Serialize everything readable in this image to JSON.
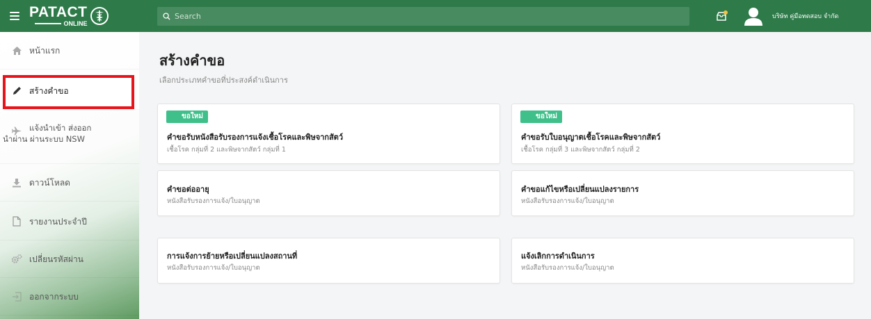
{
  "header": {
    "logo_main": "PATACT",
    "logo_sub": "ONLINE",
    "search_placeholder": "Search",
    "user_name": "บริษัท คู่มือทดสอบ จำกัด"
  },
  "sidebar": {
    "items": [
      {
        "label": "หน้าแรก",
        "icon": "home-icon"
      },
      {
        "label": "สร้างคำขอ",
        "icon": "pencil-icon"
      },
      {
        "label": "แจ้งนำเข้า ส่งออก นำผ่าน ผ่านระบบ NSW",
        "icon": "airplane-icon"
      },
      {
        "label": "ดาวน์โหลด",
        "icon": "download-icon"
      },
      {
        "label": "รายงานประจำปี",
        "icon": "document-icon"
      },
      {
        "label": "เปลี่ยนรหัสผ่าน",
        "icon": "gears-icon"
      },
      {
        "label": "ออกจากระบบ",
        "icon": "logout-icon"
      }
    ]
  },
  "main": {
    "title": "สร้างคำขอ",
    "subtitle": "เลือกประเภทคำขอที่ประสงค์ดำเนินการ",
    "cards": [
      {
        "badge": "ขอใหม่",
        "title": "คำขอรับหนังสือรับรองการแจ้งเชื้อโรคและพิษจากสัตว์",
        "subtitle": "เชื้อโรค กลุ่มที่ 2 และพิษจากสัตว์ กลุ่มที่ 1"
      },
      {
        "badge": "ขอใหม่",
        "title": "คำขอรับใบอนุญาตเชื้อโรคและพิษจากสัตว์",
        "subtitle": "เชื้อโรค กลุ่มที่ 3 และพิษจากสัตว์ กลุ่มที่ 2"
      },
      {
        "title": "คำขอต่ออายุ",
        "subtitle": "หนังสือรับรองการแจ้ง/ใบอนุญาต"
      },
      {
        "title": "คำขอแก้ไขหรือเปลี่ยนแปลงรายการ",
        "subtitle": "หนังสือรับรองการแจ้ง/ใบอนุญาต"
      },
      {
        "title": "การแจ้งการย้ายหรือเปลี่ยนแปลงสถานที่",
        "subtitle": "หนังสือรับรองการแจ้ง/ใบอนุญาต"
      },
      {
        "title": "แจ้งเลิกการดำเนินการ",
        "subtitle": "หนังสือรับรองการแจ้ง/ใบอนุญาต"
      }
    ]
  },
  "colors": {
    "header_bg": "#2e7a49",
    "badge_bg": "#3fbf8a",
    "highlight": "#e8141b"
  }
}
